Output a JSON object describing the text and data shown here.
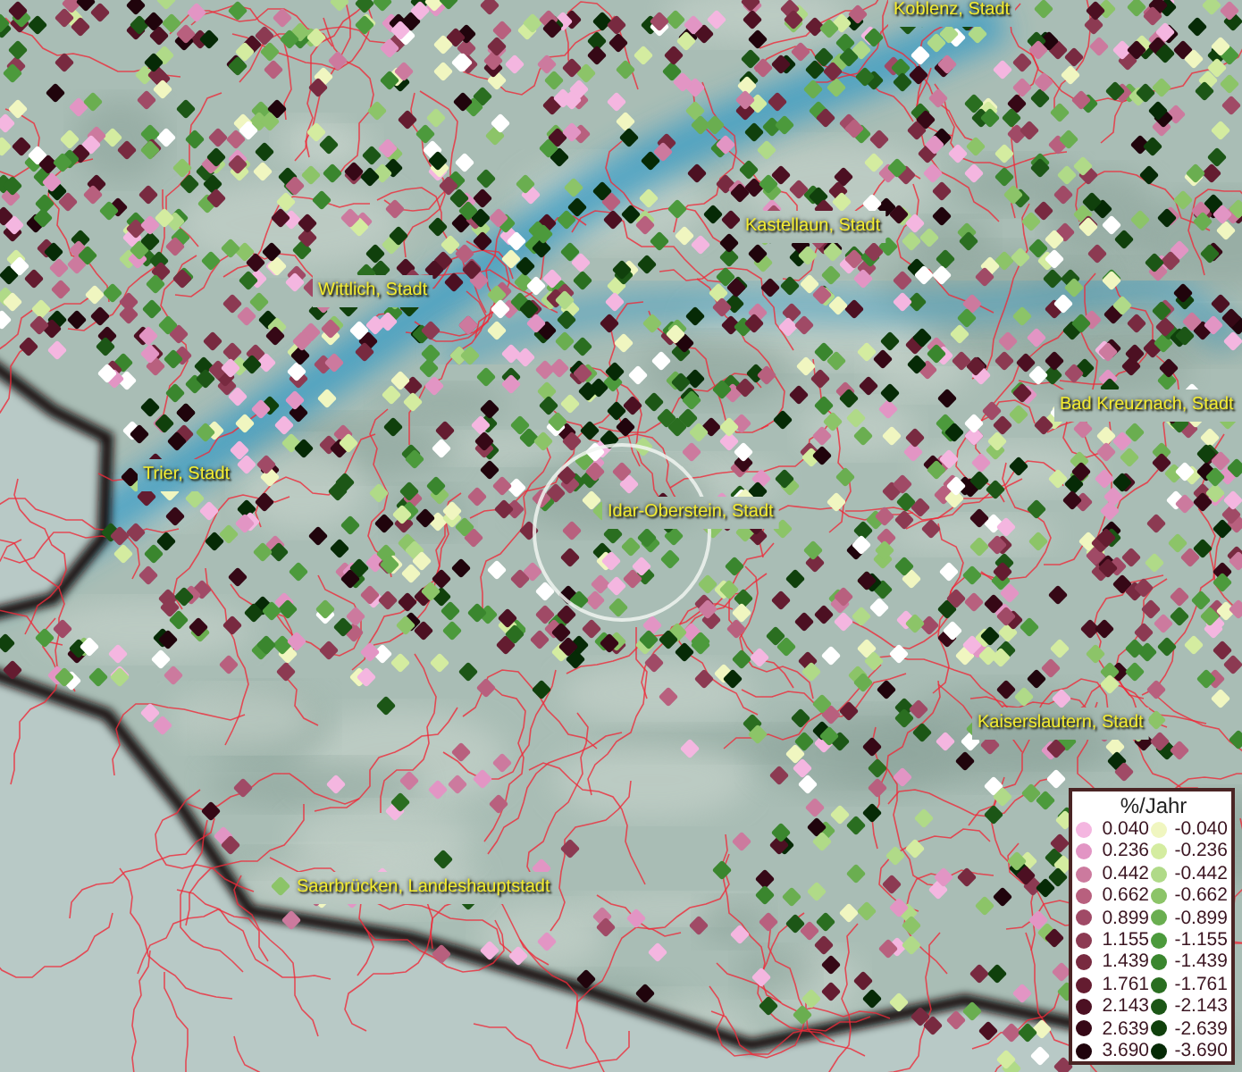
{
  "map": {
    "place_labels": [
      {
        "text": "Koblenz, Stadt"
      },
      {
        "text": "Kastellaun, Stadt"
      },
      {
        "text": "Wittlich, Stadt"
      },
      {
        "text": "Bad Kreuznach, Stadt"
      },
      {
        "text": "Trier, Stadt"
      },
      {
        "text": "Idar-Oberstein, Stadt"
      },
      {
        "text": "Kaiserslautern, Stadt"
      },
      {
        "text": "Saarbrücken, Landeshauptstadt"
      }
    ]
  },
  "legend": {
    "title": "%/Jahr",
    "rows": [
      {
        "increase": {
          "value": "0.040",
          "color": "#f4b6e0"
        },
        "decrease": {
          "value": "-0.040",
          "color": "#f0f6c0"
        }
      },
      {
        "increase": {
          "value": "0.236",
          "color": "#e295c4"
        },
        "decrease": {
          "value": "-0.236",
          "color": "#d4eca0"
        }
      },
      {
        "increase": {
          "value": "0.442",
          "color": "#cc7a9e"
        },
        "decrease": {
          "value": "-0.442",
          "color": "#b0da88"
        }
      },
      {
        "increase": {
          "value": "0.662",
          "color": "#b8607e"
        },
        "decrease": {
          "value": "-0.662",
          "color": "#8cc468"
        }
      },
      {
        "increase": {
          "value": "0.899",
          "color": "#a04a66"
        },
        "decrease": {
          "value": "-0.899",
          "color": "#6aae50"
        }
      },
      {
        "increase": {
          "value": "1.155",
          "color": "#8c3a52"
        },
        "decrease": {
          "value": "-1.155",
          "color": "#4c9a3c"
        }
      },
      {
        "increase": {
          "value": "1.439",
          "color": "#782a40"
        },
        "decrease": {
          "value": "-1.439",
          "color": "#3a862e"
        }
      },
      {
        "increase": {
          "value": "1.761",
          "color": "#641c30"
        },
        "decrease": {
          "value": "-1.761",
          "color": "#2a6e20"
        }
      },
      {
        "increase": {
          "value": "2.143",
          "color": "#4c1022"
        },
        "decrease": {
          "value": "-2.143",
          "color": "#1c5616"
        }
      },
      {
        "increase": {
          "value": "2.639",
          "color": "#360816"
        },
        "decrease": {
          "value": "-2.639",
          "color": "#10400c"
        }
      },
      {
        "increase": {
          "value": "3.690",
          "color": "#20040c"
        },
        "decrease": {
          "value": "-3.690",
          "color": "#062a06"
        }
      }
    ]
  }
}
